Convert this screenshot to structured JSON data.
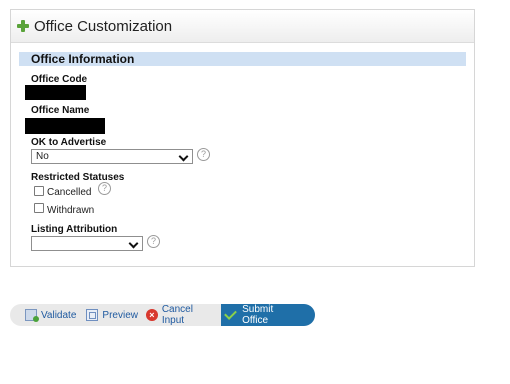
{
  "panel": {
    "title": "Office Customization"
  },
  "section": {
    "title": "Office Information"
  },
  "fields": {
    "office_code_label": "Office Code",
    "office_name_label": "Office Name",
    "ok_to_advertise_label": "OK to Advertise",
    "ok_to_advertise_value": "No",
    "restricted_statuses_label": "Restricted Statuses",
    "cancelled_label": "Cancelled",
    "withdrawn_label": "Withdrawn",
    "listing_attribution_label": "Listing Attribution",
    "listing_attribution_value": "",
    "help_glyph": "?"
  },
  "toolbar": {
    "validate_label": "Validate",
    "preview_label": "Preview",
    "cancel_label": "Cancel Input",
    "submit_label": "Submit Office",
    "cancel_glyph": "×"
  },
  "icons": {
    "expand": "plus-icon",
    "help": "help-icon",
    "validate": "validate-icon",
    "preview": "preview-icon",
    "cancel": "cancel-icon",
    "submit": "check-icon"
  },
  "colors": {
    "section_bar": "#cfe0f3",
    "submit_bg": "#1f6fa8",
    "link": "#1f5aa0",
    "plus": "#5aa33a",
    "cancel_red": "#d8382e"
  }
}
